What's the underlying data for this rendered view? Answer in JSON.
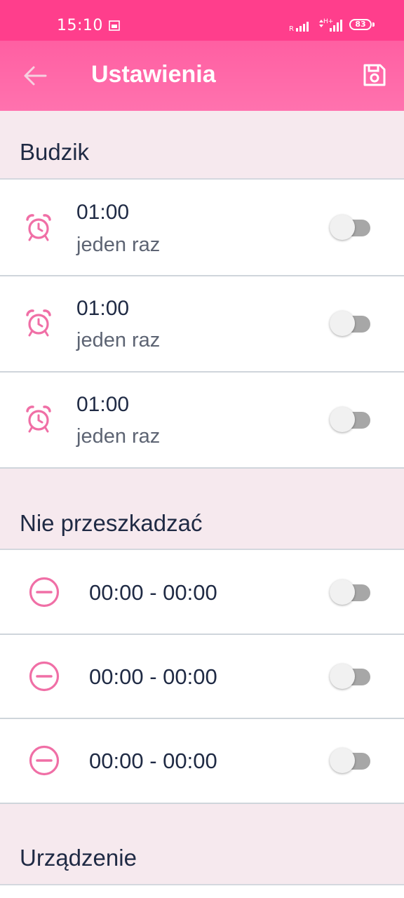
{
  "status_bar": {
    "time": "15:10",
    "battery": "83",
    "network": "H+"
  },
  "app_bar": {
    "title": "Ustawienia",
    "back_icon": "arrow-left-icon",
    "save_icon": "save-icon"
  },
  "sections": {
    "alarm": {
      "label": "Budzik"
    },
    "dnd": {
      "label": "Nie przeszkadzać"
    },
    "device": {
      "label": "Urządzenie"
    }
  },
  "alarms": [
    {
      "time": "01:00",
      "repeat": "jeden raz",
      "enabled": false
    },
    {
      "time": "01:00",
      "repeat": "jeden raz",
      "enabled": false
    },
    {
      "time": "01:00",
      "repeat": "jeden raz",
      "enabled": false
    }
  ],
  "dnd_ranges": [
    {
      "range": "00:00 - 00:00",
      "enabled": false
    },
    {
      "range": "00:00 - 00:00",
      "enabled": false
    },
    {
      "range": "00:00 - 00:00",
      "enabled": false
    }
  ],
  "colors": {
    "status_bar": "#ff3e8c",
    "app_bar": "#ff6aa8",
    "accent_icon": "#f06fa6",
    "section_bg": "#f6e9ee"
  }
}
